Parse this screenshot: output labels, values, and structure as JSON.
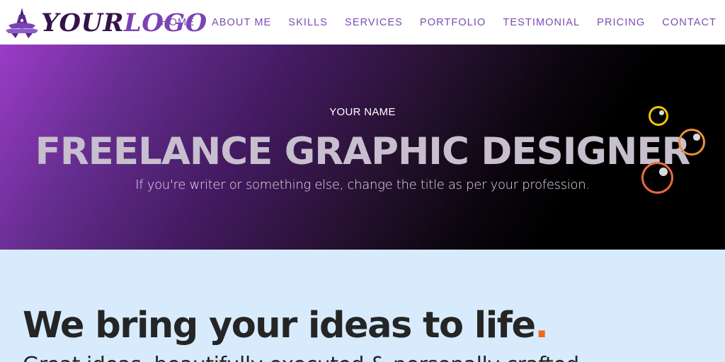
{
  "header": {
    "logo": {
      "your": "YOUR",
      "logo": "LOGO",
      "emblem_icon": "tower-emblem-icon"
    },
    "nav": [
      {
        "label": "HOME"
      },
      {
        "label": "ABOUT ME"
      },
      {
        "label": "SKILLS"
      },
      {
        "label": "SERVICES"
      },
      {
        "label": "PORTFOLIO"
      },
      {
        "label": "TESTIMONIAL"
      },
      {
        "label": "PRICING"
      },
      {
        "label": "CONTACT"
      }
    ]
  },
  "hero": {
    "name": "YOUR NAME",
    "title": "FREELANCE GRAPHIC DESIGNER",
    "subtitle": "If you're writer or something else, change the title as per your profession."
  },
  "intro": {
    "headline_pre": "We bring your ",
    "headline_bold": "ideas",
    "headline_post": " to life",
    "headline_dot": ".",
    "subline": "Great ideas, beautifully executed & personally crafted"
  },
  "colors": {
    "nav_text": "#7a4db1",
    "logo_dark": "#35124a",
    "logo_light": "#7a43b4",
    "hero_gradient_start": "#9b3cc8",
    "hero_gradient_end": "#000000",
    "intro_background": "#d8ebfd",
    "accent_dot": "#f06a1a",
    "bubble_yellow": "#f5c400",
    "bubble_orange": "#f0913a",
    "bubble_red": "#ea6a3d"
  }
}
